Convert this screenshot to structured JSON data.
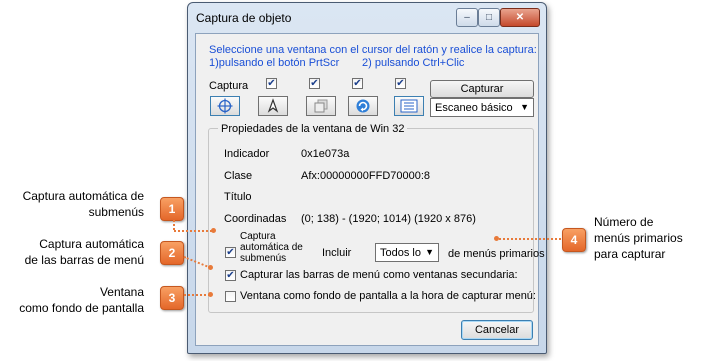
{
  "window": {
    "title": "Captura de objeto",
    "controls": {
      "minimize": "–",
      "maximize": "□",
      "close": "✕"
    }
  },
  "instructions": {
    "line1": "Seleccione una ventana con el cursor del ratón y realice la captura:",
    "line2a": "1)pulsando el botón PrtScr",
    "line2b": "2) pulsando Ctrl+Clic"
  },
  "toolbar": {
    "captura_label": "Captura",
    "tools": [
      {
        "icon": "crosshair-icon",
        "checked": true
      },
      {
        "icon": "cursor-icon",
        "checked": true
      },
      {
        "icon": "window-stack-icon",
        "checked": true
      },
      {
        "icon": "refresh-icon",
        "checked": true
      },
      {
        "icon": "form-list-icon",
        "checked": true
      }
    ],
    "capture_button": "Capturar",
    "scan_mode": {
      "selected": "Escaneo básico"
    }
  },
  "properties": {
    "group_title": "Propiedades de la ventana de Win 32",
    "rows": [
      {
        "label": "Indicador",
        "value": "0x1e073a"
      },
      {
        "label": "Clase",
        "value": "Afx:00000000FFD70000:8"
      },
      {
        "label": "Título",
        "value": ""
      },
      {
        "label": "Coordinadas",
        "value": "(0; 138) - (1920; 1014) (1920 x 876)"
      }
    ]
  },
  "options": {
    "auto_submenu": {
      "label_line1": "Captura",
      "label_line2": "automática de",
      "label_line3": "submenús",
      "checked": true,
      "include_label": "Incluir",
      "include_selected": "Todos lo",
      "suffix": "de menús primarios"
    },
    "menu_bars": {
      "label": "Capturar las barras de menú como ventanas secundaria:",
      "checked": true
    },
    "wallpaper": {
      "label": "Ventana como fondo de pantalla a la hora de capturar menú:",
      "checked": false
    }
  },
  "cancel_button": "Cancelar",
  "callouts": [
    {
      "number": "1",
      "line1": "Captura automática de",
      "line2": "submenús"
    },
    {
      "number": "2",
      "line1": "Captura automática",
      "line2": "de las barras de menú"
    },
    {
      "number": "3",
      "line1": "Ventana",
      "line2": "como fondo de pantalla"
    },
    {
      "number": "4",
      "line1": "Número de",
      "line2": "menús primarios",
      "line3": "para capturar"
    }
  ],
  "colors": {
    "accent": "#e87a3a",
    "instruction_text": "#1a4fd6"
  }
}
